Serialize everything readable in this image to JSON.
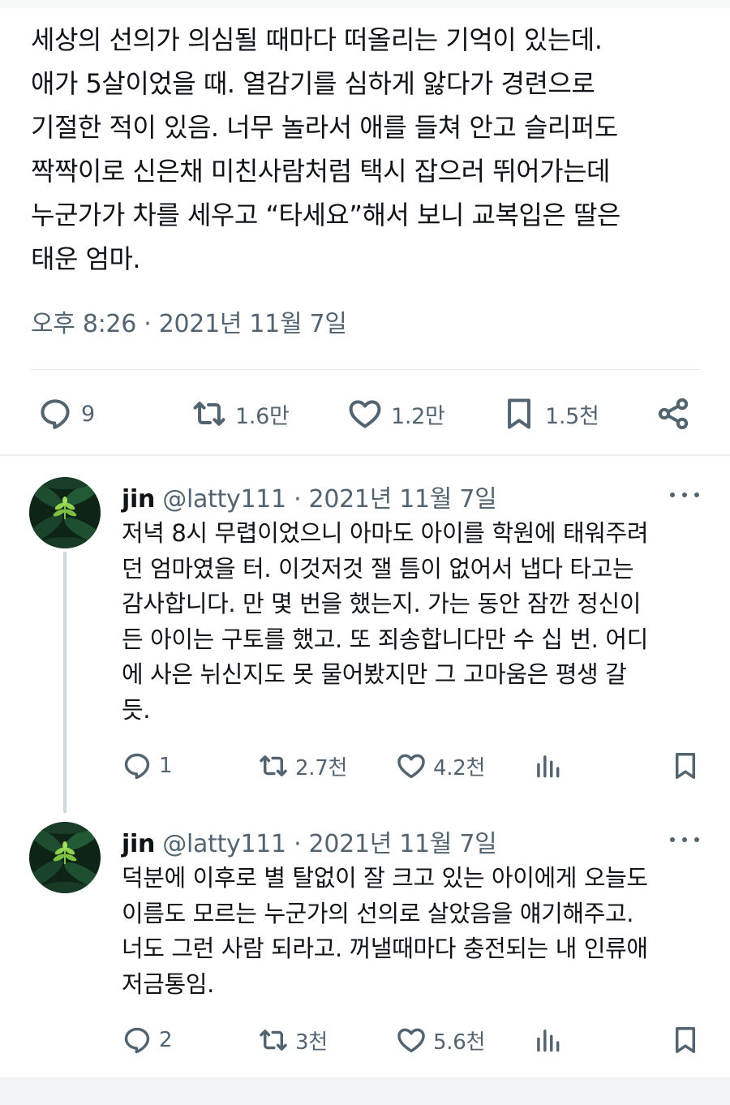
{
  "tweet": {
    "text": "세상의 선의가 의심될 때마다 떠올리는 기억이 있는데.\n애가 5살이었을 때. 열감기를 심하게 앓다가 경련으로\n기절한 적이 있음. 너무 놀라서 애를 들쳐 안고 슬리퍼도\n짝짝이로 신은채 미친사람처럼 택시 잡으러 뛰어가는데\n누군가가 차를 세우고 “타세요”해서 보니 교복입은 딸은\n태운 엄마.",
    "timestamp": "오후 8:26 · 2021년 11월 7일",
    "actions": {
      "reply_count": "9",
      "retweet_count": "1.6만",
      "like_count": "1.2만",
      "bookmark_count": "1.5천"
    }
  },
  "replies": [
    {
      "name": "jin",
      "meta": "@latty111 · 2021년 11월 7일",
      "text": "저녁 8시 무렵이었으니 아마도 아이를 학원에 태워주려\n던 엄마였을 터. 이것저것 잴 틈이 없어서 냅다 타고는\n감사합니다. 만 몇 번을 했는지. 가는 동안 잠깐 정신이\n든 아이는 구토를 했고. 또 죄송합니다만 수 십 번. 어디\n에 사은 뉘신지도 못 물어봤지만 그 고마움은 평생 갈\n듯.",
      "reply_count": "1",
      "retweet_count": "2.7천",
      "like_count": "4.2천"
    },
    {
      "name": "jin",
      "meta": "@latty111 · 2021년 11월 7일",
      "text": "덕분에 이후로 별 탈없이 잘 크고 있는 아이에게 오늘도\n이름도 모르는 누군가의 선의로 살았음을 얘기해주고.\n너도 그런 사람 되라고. 꺼낼때마다 충전되는 내 인류애\n저금통임.",
      "reply_count": "2",
      "retweet_count": "3천",
      "like_count": "5.6천"
    }
  ],
  "colors": {
    "text": "#0f1419",
    "secondary": "#536471",
    "divider": "#e6ecf0",
    "thread_line": "#cfd9de"
  },
  "icons": [
    "reply-icon",
    "retweet-icon",
    "like-icon",
    "bookmark-icon",
    "share-icon",
    "views-icon",
    "more-icon"
  ]
}
